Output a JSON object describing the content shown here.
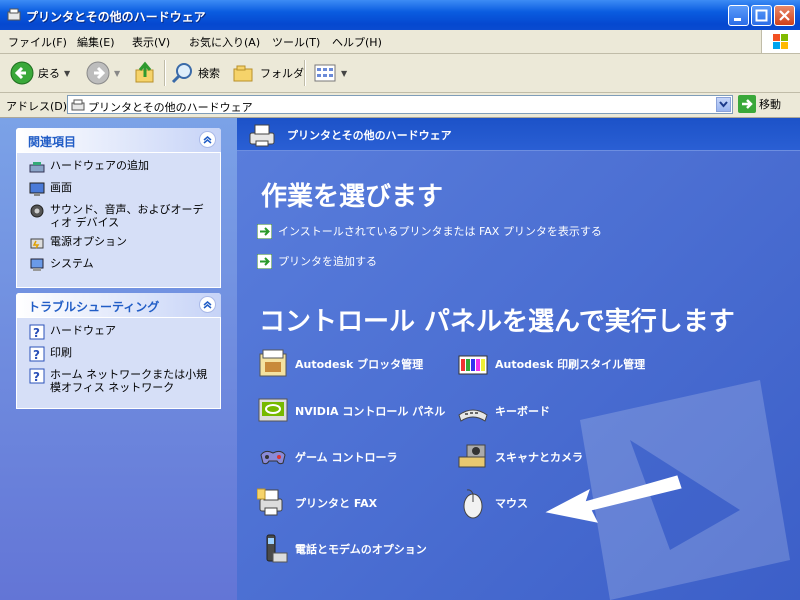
{
  "window": {
    "title": "プリンタとその他のハードウェア"
  },
  "menubar": {
    "items": [
      "ファイル(F)",
      "編集(E)",
      "表示(V)",
      "お気に入り(A)",
      "ツール(T)",
      "ヘルプ(H)"
    ]
  },
  "toolbar": {
    "back_label": "戻る",
    "search_label": "検索",
    "folders_label": "フォルダ"
  },
  "address": {
    "label": "アドレス(D)",
    "value": "プリンタとその他のハードウェア",
    "go_label": "移動"
  },
  "sidebar": {
    "related": {
      "title": "関連項目",
      "items": [
        {
          "label": "ハードウェアの追加",
          "icon": "hardware-add-icon"
        },
        {
          "label": "画面",
          "icon": "display-icon"
        },
        {
          "label": "サウンド、音声、およびオーディオ デバイス",
          "icon": "sound-icon"
        },
        {
          "label": "電源オプション",
          "icon": "power-icon"
        },
        {
          "label": "システム",
          "icon": "system-icon"
        }
      ]
    },
    "troubleshoot": {
      "title": "トラブルシューティング",
      "items": [
        {
          "label": "ハードウェア",
          "icon": "help-icon"
        },
        {
          "label": "印刷",
          "icon": "help-icon"
        },
        {
          "label": "ホーム ネットワークまたは小規模オフィス ネットワーク",
          "icon": "help-icon"
        }
      ]
    }
  },
  "main": {
    "header": "プリンタとその他のハードウェア",
    "tasks_title": "作業を選びます",
    "tasks": [
      "インストールされているプリンタまたは FAX プリンタを表示する",
      "プリンタを追加する"
    ],
    "cp_title": "コントロール パネルを選んで実行します",
    "cp_items": [
      {
        "label": "Autodesk ブロッタ管理",
        "icon": "plotter-icon"
      },
      {
        "label": "Autodesk 印刷スタイル管理",
        "icon": "print-style-icon"
      },
      {
        "label": "NVIDIA コントロール パネル",
        "icon": "nvidia-icon"
      },
      {
        "label": "キーボード",
        "icon": "keyboard-icon"
      },
      {
        "label": "ゲーム コントローラ",
        "icon": "gamepad-icon"
      },
      {
        "label": "スキャナとカメラ",
        "icon": "scanner-icon"
      },
      {
        "label": "プリンタと FAX",
        "icon": "printer-icon"
      },
      {
        "label": "マウス",
        "icon": "mouse-icon"
      },
      {
        "label": "電話とモデムのオプション",
        "icon": "phone-icon"
      }
    ]
  },
  "colors": {
    "title_bar": "#0a5ce0",
    "sidebar_bg": "#7ba2e7",
    "main_bg": "#4a6fd6",
    "link_text": "#ffffff"
  }
}
